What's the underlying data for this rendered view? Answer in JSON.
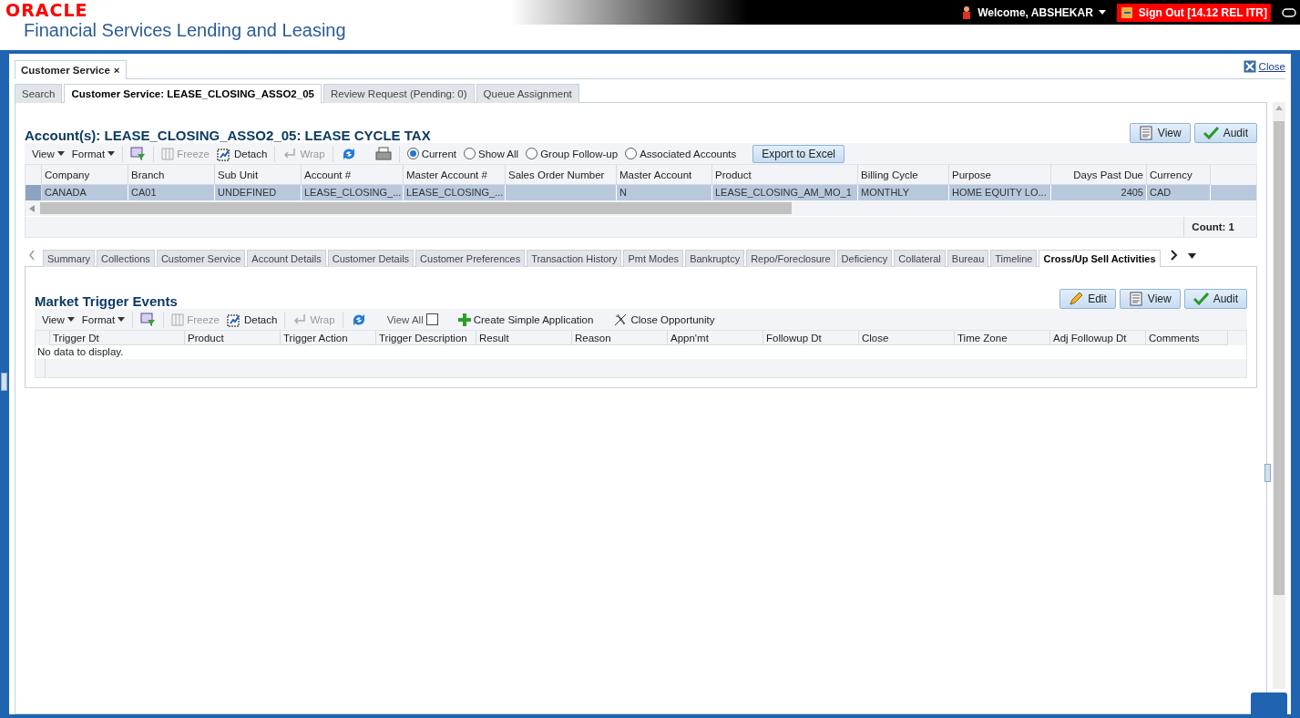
{
  "header": {
    "brand": "ORACLE",
    "product": "Financial Services Lending and Leasing",
    "welcome": "Welcome, ABSHEKAR",
    "sign_out": "Sign Out [14.12 REL ITR]"
  },
  "outer_tab": {
    "label": "Customer Service",
    "close": "×"
  },
  "close_link": "Close",
  "tabs": [
    {
      "label": "Search",
      "selected": false
    },
    {
      "label": "Customer Service: LEASE_CLOSING_ASSO2_05",
      "selected": true
    },
    {
      "label": "Review Request (Pending: 0)",
      "selected": false
    },
    {
      "label": "Queue Assignment",
      "selected": false
    }
  ],
  "accounts": {
    "title": "Account(s): LEASE_CLOSING_ASSO2_05: LEASE CYCLE TAX",
    "buttons": [
      {
        "label": "View",
        "kind": "view"
      },
      {
        "label": "Audit",
        "kind": "audit"
      }
    ],
    "toolbar": {
      "view": "View",
      "format": "Format",
      "freeze": "Freeze",
      "detach": "Detach",
      "wrap": "Wrap"
    },
    "filters": [
      {
        "label": "Current",
        "selected": true
      },
      {
        "label": "Show All",
        "selected": false
      },
      {
        "label": "Group Follow-up",
        "selected": false
      },
      {
        "label": "Associated Accounts",
        "selected": false
      }
    ],
    "export": "Export to Excel",
    "columns": [
      "Company",
      "Branch",
      "Sub Unit",
      "Account #",
      "Master Account #",
      "Sales Order Number",
      "Master Account",
      "Product",
      "Billing Cycle",
      "Purpose",
      "Days Past Due",
      "Currency"
    ],
    "rows": [
      {
        "selected": true,
        "cells": [
          "CANADA",
          "CA01",
          "UNDEFINED",
          "LEASE_CLOSING_...",
          "LEASE_CLOSING_...",
          "",
          "N",
          "LEASE_CLOSING_AM_MO_1",
          "MONTHLY",
          "HOME EQUITY LO...",
          "2405",
          "CAD"
        ]
      }
    ],
    "count": "Count: 1"
  },
  "detail_tabs": [
    {
      "label": "Summary",
      "selected": false
    },
    {
      "label": "Collections",
      "selected": false
    },
    {
      "label": "Customer Service",
      "selected": false
    },
    {
      "label": "Account Details",
      "selected": false
    },
    {
      "label": "Customer Details",
      "selected": false
    },
    {
      "label": "Customer Preferences",
      "selected": false
    },
    {
      "label": "Transaction History",
      "selected": false
    },
    {
      "label": "Pmt Modes",
      "selected": false
    },
    {
      "label": "Bankruptcy",
      "selected": false
    },
    {
      "label": "Repo/Foreclosure",
      "selected": false
    },
    {
      "label": "Deficiency",
      "selected": false
    },
    {
      "label": "Collateral",
      "selected": false
    },
    {
      "label": "Bureau",
      "selected": false
    },
    {
      "label": "Timeline",
      "selected": false
    },
    {
      "label": "Cross/Up Sell Activities",
      "selected": true
    }
  ],
  "market": {
    "title": "Market Trigger Events",
    "buttons": [
      {
        "label": "Edit",
        "kind": "edit"
      },
      {
        "label": "View",
        "kind": "view"
      },
      {
        "label": "Audit",
        "kind": "audit"
      }
    ],
    "toolbar": {
      "view": "View",
      "format": "Format",
      "freeze": "Freeze",
      "detach": "Detach",
      "wrap": "Wrap"
    },
    "view_all": {
      "label": "View All",
      "checked": false
    },
    "actions": [
      {
        "label": "Create Simple Application",
        "kind": "create"
      },
      {
        "label": "Close Opportunity",
        "kind": "close"
      }
    ],
    "columns": [
      "Trigger Dt",
      "Product",
      "Trigger Action",
      "Trigger Description",
      "Result",
      "Reason",
      "Appn'mt",
      "Followup Dt",
      "Close",
      "Time Zone",
      "Adj Followup Dt",
      "Comments"
    ],
    "empty": "No data to display."
  }
}
